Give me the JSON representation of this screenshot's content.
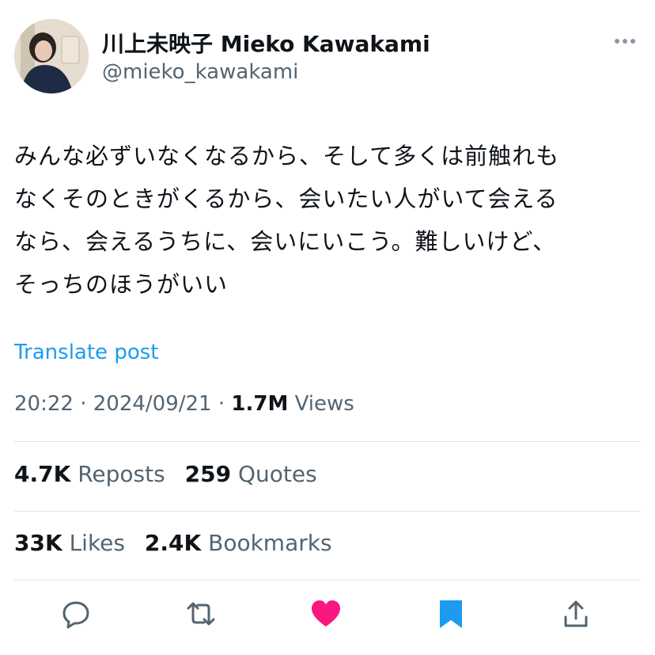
{
  "tweet": {
    "author_name": "川上未映子 Mieko Kawakami",
    "handle": "@mieko_kawakami",
    "text_lines": [
      "みんな必ずいなくなるから、そして多くは前触れも",
      "なくそのときがくるから、会いたい人がいて会える",
      "なら、会えるうちに、会いにいこう。難しいけど、",
      "そっちのほうがいい"
    ],
    "translate_label": "Translate post",
    "time": "20:22",
    "date": "2024/09/21",
    "views_count": "1.7M",
    "views_label": "Views"
  },
  "stats": {
    "reposts_count": "4.7K",
    "reposts_label": "Reposts",
    "quotes_count": "259",
    "quotes_label": "Quotes",
    "likes_count": "33K",
    "likes_label": "Likes",
    "bookmarks_count": "2.4K",
    "bookmarks_label": "Bookmarks"
  },
  "colors": {
    "link": "#1d9bf0",
    "like": "#f91880",
    "bookmark": "#1d9bf0",
    "secondary_text": "#536471"
  },
  "icons": [
    "more-icon",
    "reply-icon",
    "repost-icon",
    "like-icon",
    "bookmark-icon",
    "share-icon"
  ]
}
